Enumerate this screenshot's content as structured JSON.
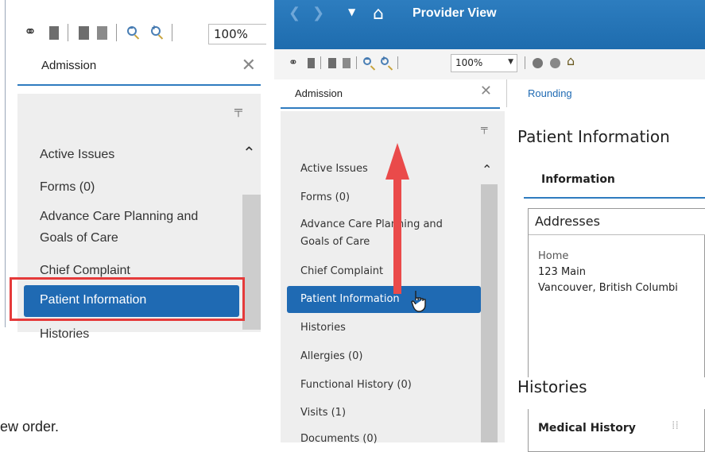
{
  "left_panel": {
    "zoom_value": "100%",
    "tab_label": "Admission",
    "items": [
      "Active Issues",
      "Forms (0)",
      "Advance Care Planning and",
      "Goals of Care",
      "Chief Complaint",
      "Patient Information",
      "Histories"
    ]
  },
  "caption": "ew order.",
  "app": {
    "title": "Provider View",
    "zoom_value": "100%",
    "tabs": [
      "Admission",
      "Rounding"
    ],
    "nav_items": [
      "Active Issues",
      "Forms (0)",
      "Advance Care Planning and",
      "Goals of Care",
      "Chief Complaint",
      "Patient Information",
      "Histories",
      "Allergies (0)",
      "Functional History (0)",
      "Visits (1)",
      "Documents (0)"
    ],
    "active_item": "Patient Information",
    "content": {
      "section_title": "Patient Information",
      "info_tab": "Information",
      "addresses_header": "Addresses",
      "address_type": "Home",
      "address_line1": "123 Main",
      "address_line2": "Vancouver, British Columbi",
      "histories_title": "Histories",
      "medical_history": "Medical History"
    }
  },
  "colors": {
    "accent_blue": "#1f6ab3",
    "highlight_red": "#e53a3a",
    "arrow_red": "#ea4a4a"
  },
  "icons": [
    "binoculars-icon",
    "page-icon",
    "zoom-out-icon",
    "zoom-in-icon",
    "home-icon",
    "pin-icon",
    "close-icon",
    "pointer-hand-icon",
    "chevron-up-icon"
  ]
}
